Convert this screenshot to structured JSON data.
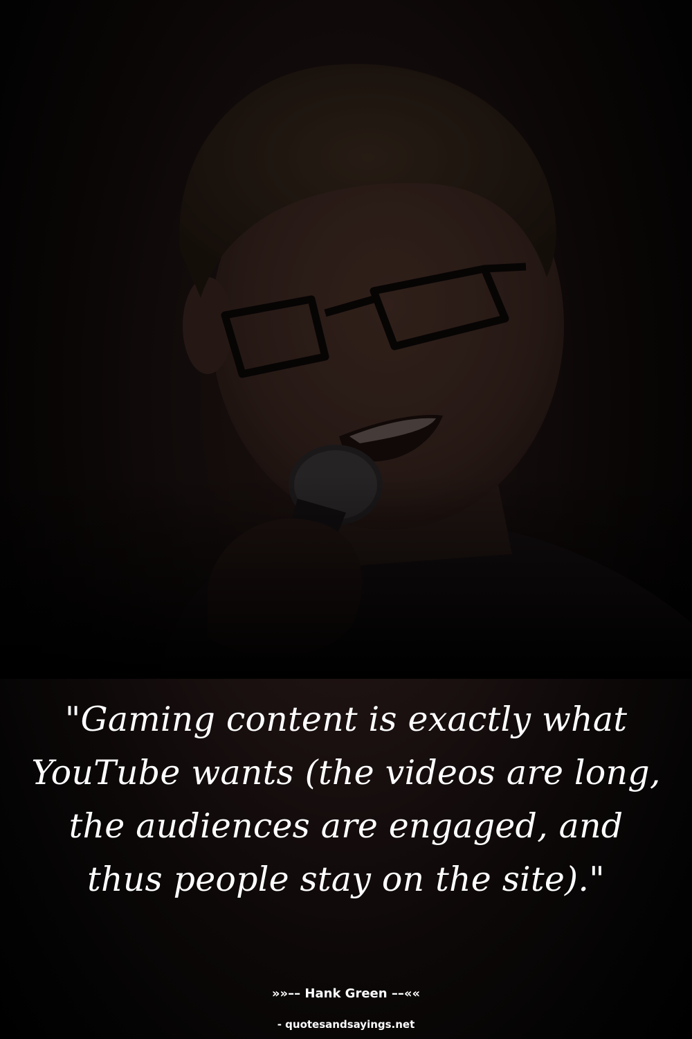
{
  "photo": {
    "subject_icon": "person-with-glasses-and-microphone-photo"
  },
  "quote": {
    "text": "\"Gaming content is exactly what YouTube wants (the videos are long, the audiences are engaged, and thus people stay on the site).\""
  },
  "author": {
    "line": "»»–– Hank Green ––««"
  },
  "source": {
    "text": "- quotesandsayings.net"
  },
  "colors": {
    "background": "#000000",
    "text": "#ffffff"
  }
}
